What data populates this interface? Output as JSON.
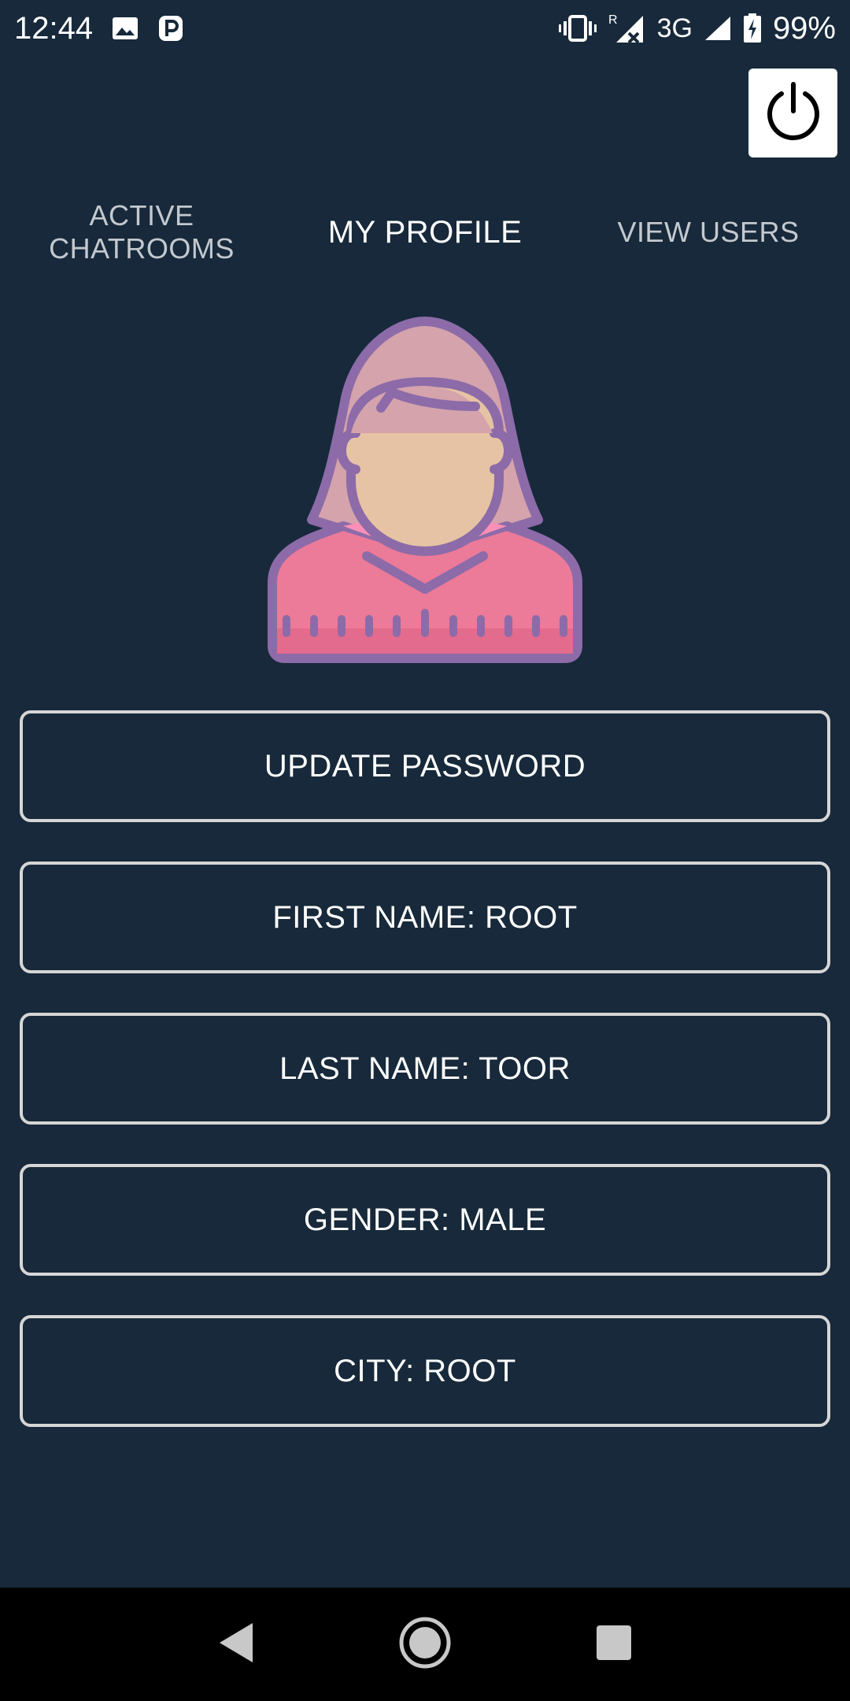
{
  "status_bar": {
    "time": "12:44",
    "network": "3G",
    "roaming": "R",
    "battery": "99%",
    "icons": [
      "image-icon",
      "parking-p-icon",
      "vibrate-icon",
      "signal-icon",
      "battery-charging-icon"
    ]
  },
  "header": {
    "power_icon": "power-icon"
  },
  "tabs": [
    {
      "label": "ACTIVE\nCHATROOMS",
      "active": false
    },
    {
      "label": "MY PROFILE",
      "active": true
    },
    {
      "label": "VIEW USERS",
      "active": false
    }
  ],
  "profile": {
    "avatar_icon": "female-user-avatar-icon",
    "update_password": "UPDATE PASSWORD",
    "first_name": "FIRST NAME: ROOT",
    "last_name": "LAST NAME: TOOR",
    "gender": "GENDER: MALE",
    "city": "CITY: ROOT"
  },
  "nav_bar": {
    "icons": [
      "back-icon",
      "home-icon",
      "recents-icon"
    ]
  },
  "colors": {
    "background": "#17293a",
    "border": "#d6d6d6",
    "text": "#ffffff",
    "tab_inactive": "#c3c9cf"
  }
}
